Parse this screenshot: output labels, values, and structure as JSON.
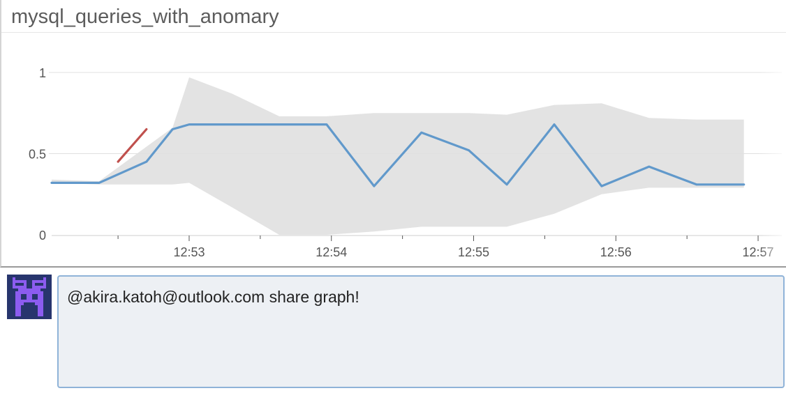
{
  "panel": {
    "title": "mysql_queries_with_anomary"
  },
  "chart_data": {
    "type": "line",
    "title": "mysql_queries_with_anomary",
    "xlabel": "",
    "ylabel": "",
    "ylim": [
      0,
      1.1
    ],
    "y_ticks": [
      {
        "value": 0,
        "label": "0"
      },
      {
        "value": 0.5,
        "label": "0.5"
      },
      {
        "value": 1,
        "label": "1"
      }
    ],
    "x_ticks": [
      "12:53",
      "12:54",
      "12:55",
      "12:56",
      "12:57"
    ],
    "x_domain": [
      "12:52:02",
      "12:57:10"
    ],
    "grid": true,
    "series": [
      {
        "color": "#6199cb",
        "x": [
          "12:52:02",
          "12:52:22",
          "12:52:42",
          "12:52:53",
          "12:53:00",
          "12:53:40",
          "12:53:58",
          "12:54:18",
          "12:54:38",
          "12:54:58",
          "12:55:14",
          "12:55:34",
          "12:55:54",
          "12:56:14",
          "12:56:34",
          "12:56:54"
        ],
        "y": [
          0.32,
          0.32,
          0.45,
          0.65,
          0.68,
          0.68,
          0.68,
          0.3,
          0.63,
          0.52,
          0.31,
          0.68,
          0.3,
          0.42,
          0.31,
          0.31
        ]
      },
      {
        "color": "#c0504d",
        "x": [
          "12:52:30",
          "12:52:42"
        ],
        "y": [
          0.45,
          0.65
        ]
      }
    ],
    "band": {
      "color": "#e3e3e3",
      "x": [
        "12:52:02",
        "12:52:22",
        "12:52:53",
        "12:53:00",
        "12:53:18",
        "12:53:38",
        "12:53:58",
        "12:54:18",
        "12:54:38",
        "12:54:58",
        "12:55:14",
        "12:55:34",
        "12:55:54",
        "12:56:14",
        "12:56:34",
        "12:56:54"
      ],
      "upper": [
        0.34,
        0.33,
        0.66,
        0.97,
        0.87,
        0.73,
        0.73,
        0.75,
        0.75,
        0.75,
        0.74,
        0.8,
        0.81,
        0.72,
        0.71,
        0.71
      ],
      "lower": [
        0.32,
        0.31,
        0.31,
        0.32,
        0.17,
        0.0,
        0.0,
        0.02,
        0.05,
        0.05,
        0.05,
        0.13,
        0.25,
        0.29,
        0.29,
        0.29
      ]
    }
  },
  "comment": {
    "text": "@akira.katoh@outlook.com share graph!"
  },
  "avatar": {
    "bg_color": "#27356d",
    "fg_color": "#8c5cf0"
  }
}
